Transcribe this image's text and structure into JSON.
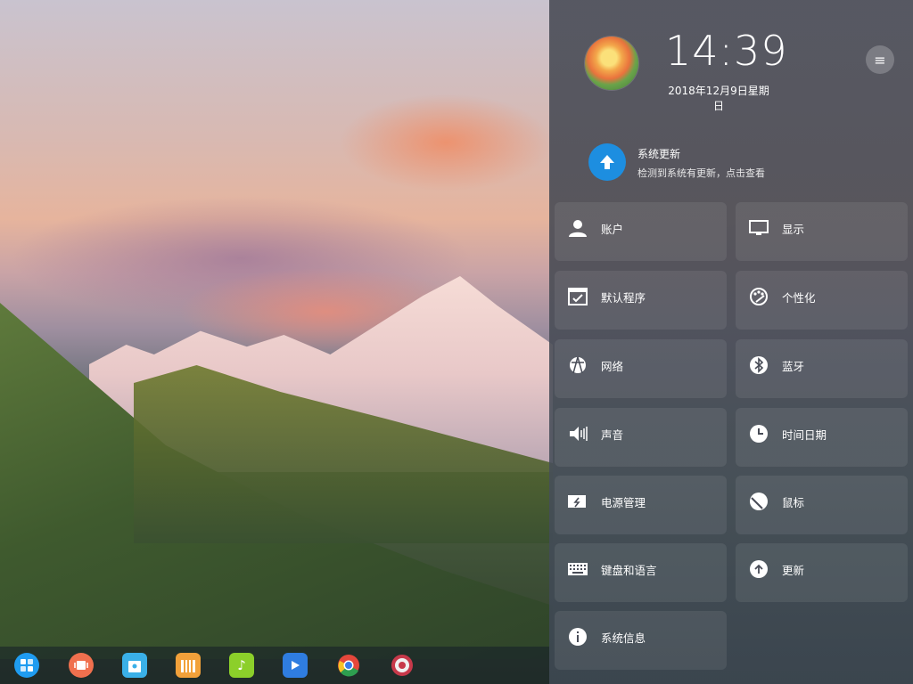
{
  "dock": {
    "items": [
      {
        "name": "launcher",
        "icon": "launcher-icon",
        "color": "#1f9cf0"
      },
      {
        "name": "multitask-view",
        "icon": "multitask-icon",
        "color": "#f0704e"
      },
      {
        "name": "app-store",
        "icon": "store-icon",
        "color": "#3ab0e8"
      },
      {
        "name": "archive-manager",
        "icon": "archive-icon",
        "color": "#f2a13a"
      },
      {
        "name": "music-player",
        "icon": "music-icon",
        "color": "#8ccf2a"
      },
      {
        "name": "movie-player",
        "icon": "movie-icon",
        "color": "#2f7de0"
      },
      {
        "name": "chrome-browser",
        "icon": "chrome-icon",
        "color": "#e5473b"
      },
      {
        "name": "control-center",
        "icon": "settings-gear-icon",
        "color": "#c7394a"
      }
    ]
  },
  "control_center": {
    "time": "14:39",
    "date": "2018年12月9日星期日",
    "menu_icon": "hamburger-icon",
    "update": {
      "title": "系统更新",
      "subtitle": "检测到系统有更新，点击查看",
      "icon": "upload-arrow-icon",
      "color": "#1d8ee0"
    },
    "tiles": [
      {
        "label": "账户",
        "icon": "user-icon"
      },
      {
        "label": "显示",
        "icon": "monitor-icon"
      },
      {
        "label": "默认程序",
        "icon": "default-app-icon"
      },
      {
        "label": "个性化",
        "icon": "palette-icon"
      },
      {
        "label": "网络",
        "icon": "network-icon"
      },
      {
        "label": "蓝牙",
        "icon": "bluetooth-icon"
      },
      {
        "label": "声音",
        "icon": "speaker-icon"
      },
      {
        "label": "时间日期",
        "icon": "clock-icon"
      },
      {
        "label": "电源管理",
        "icon": "battery-icon"
      },
      {
        "label": "鼠标",
        "icon": "mouse-icon"
      },
      {
        "label": "键盘和语言",
        "icon": "keyboard-icon"
      },
      {
        "label": "更新",
        "icon": "update-arrow-icon"
      },
      {
        "label": "系统信息",
        "icon": "info-icon"
      }
    ]
  }
}
